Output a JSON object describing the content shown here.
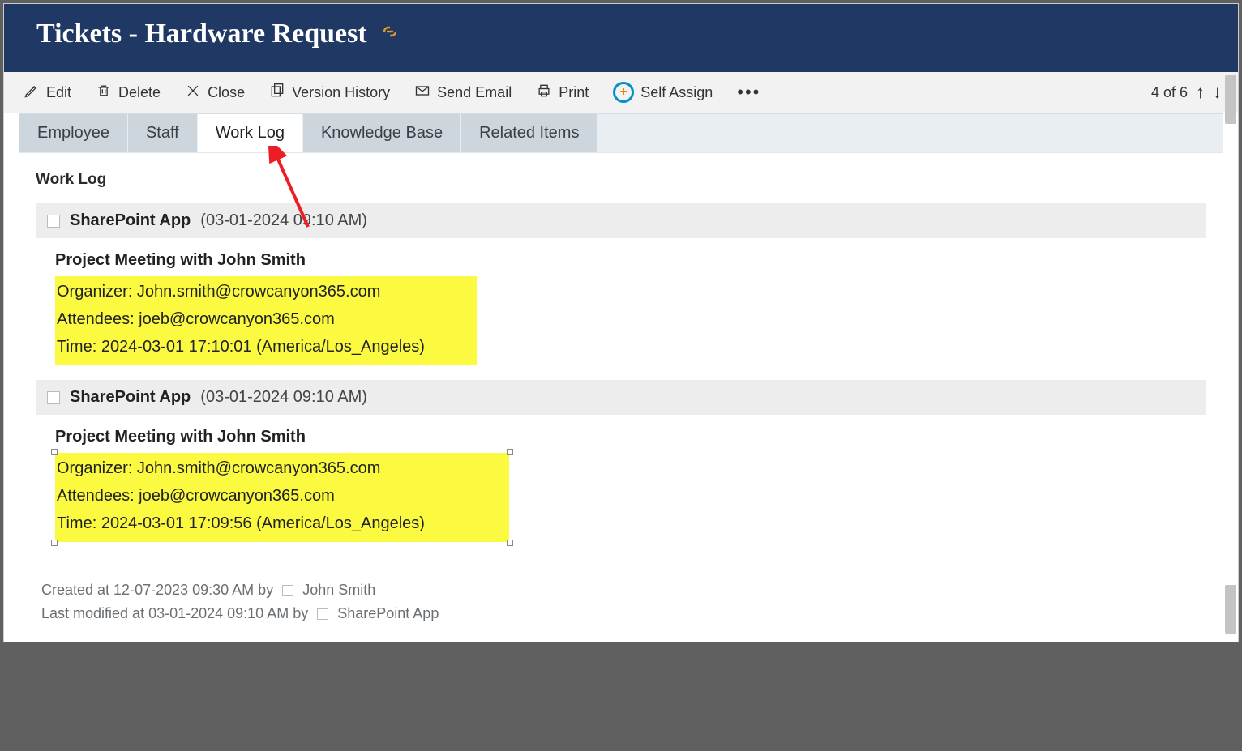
{
  "header": {
    "title": "Tickets - Hardware Request"
  },
  "toolbar": {
    "edit": "Edit",
    "delete": "Delete",
    "close": "Close",
    "versionHistory": "Version History",
    "sendEmail": "Send Email",
    "print": "Print",
    "selfAssign": "Self Assign",
    "pager": "4 of 6"
  },
  "tabs": {
    "t0": "Employee",
    "t1": "Staff",
    "t2": "Work Log",
    "t3": "Knowledge Base",
    "t4": "Related Items"
  },
  "section": {
    "title": "Work Log"
  },
  "entries": [
    {
      "author": "SharePoint App",
      "date": "(03-01-2024 09:10 AM)",
      "meetingTitle": "Project Meeting with John Smith",
      "organizer": "Organizer: John.smith@crowcanyon365.com",
      "attendees": "Attendees: joeb@crowcanyon365.com",
      "time": "Time: 2024-03-01 17:10:01 (America/Los_Angeles)"
    },
    {
      "author": "SharePoint App",
      "date": "(03-01-2024 09:10 AM)",
      "meetingTitle": "Project Meeting with John Smith",
      "organizer": "Organizer: John.smith@crowcanyon365.com",
      "attendees": "Attendees: joeb@crowcanyon365.com",
      "time": "Time: 2024-03-01 17:09:56 (America/Los_Angeles)"
    }
  ],
  "footer": {
    "createdPrefix": "Created at 12-07-2023 09:30 AM by ",
    "createdBy": " John Smith",
    "modifiedPrefix": "Last modified at 03-01-2024 09:10 AM by ",
    "modifiedBy": " SharePoint App"
  }
}
